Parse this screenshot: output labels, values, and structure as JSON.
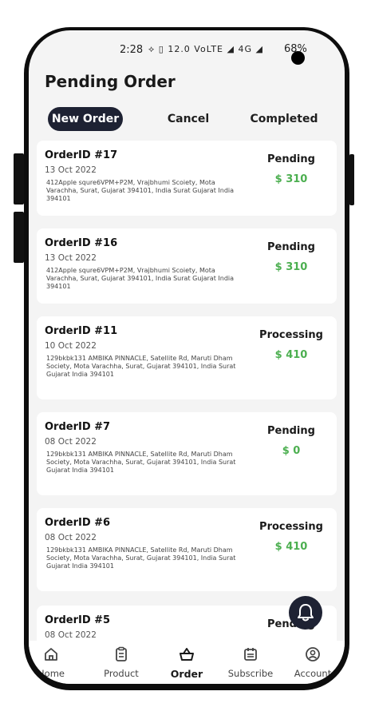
{
  "status_bar": {
    "time": "2:28",
    "icons_text": "⟡     ▯  12.0  VoLTE  ◢ 4G ◢",
    "battery": "68%"
  },
  "page": {
    "title": "Pending Order"
  },
  "tabs": [
    {
      "label": "New Order",
      "active": true
    },
    {
      "label": "Cancel",
      "active": false
    },
    {
      "label": "Completed",
      "active": false
    }
  ],
  "orders": [
    {
      "id": "OrderID #17",
      "date": "13 Oct 2022",
      "address": "412Apple squre6VPM+P2M, Vrajbhumi Scoiety, Mota Varachha, Surat, Gujarat 394101, India Surat Gujarat India 394101",
      "status": "Pending",
      "price": "$ 310"
    },
    {
      "id": "OrderID #16",
      "date": "13 Oct 2022",
      "address": "412Apple squre6VPM+P2M, Vrajbhumi Scoiety, Mota Varachha, Surat, Gujarat 394101, India Surat Gujarat India 394101",
      "status": "Pending",
      "price": "$ 310"
    },
    {
      "id": "OrderID #11",
      "date": "10 Oct 2022",
      "address": "129bkbk131 AMBIKA PINNACLE, Satellite Rd, Maruti Dham Society, Mota Varachha, Surat, Gujarat 394101, India Surat Gujarat India 394101",
      "status": "Processing",
      "price": "$ 410"
    },
    {
      "id": "OrderID #7",
      "date": "08 Oct 2022",
      "address": "129bkbk131 AMBIKA PINNACLE, Satellite Rd, Maruti Dham Society, Mota Varachha, Surat, Gujarat 394101, India Surat Gujarat India 394101",
      "status": "Pending",
      "price": "$ 0"
    },
    {
      "id": "OrderID #6",
      "date": "08 Oct 2022",
      "address": "129bkbk131 AMBIKA PINNACLE, Satellite Rd, Maruti Dham Society, Mota Varachha, Surat, Gujarat 394101, India Surat Gujarat India 394101",
      "status": "Processing",
      "price": "$ 410"
    },
    {
      "id": "OrderID #5",
      "date": "08 Oct 2022",
      "address": "",
      "status": "Pending",
      "price": ""
    }
  ],
  "nav": [
    {
      "label": "Home",
      "icon": "home-icon",
      "active": false
    },
    {
      "label": "Product",
      "icon": "clipboard-icon",
      "active": false
    },
    {
      "label": "Order",
      "icon": "basket-icon",
      "active": true
    },
    {
      "label": "Subscribe",
      "icon": "calendar-icon",
      "active": false
    },
    {
      "label": "Account",
      "icon": "user-circle-icon",
      "active": false
    }
  ],
  "fab": {
    "icon": "bell-icon"
  },
  "colors": {
    "accent": "#1e2233",
    "price": "#4caf50",
    "background": "#f4f4f4",
    "card": "#ffffff"
  }
}
